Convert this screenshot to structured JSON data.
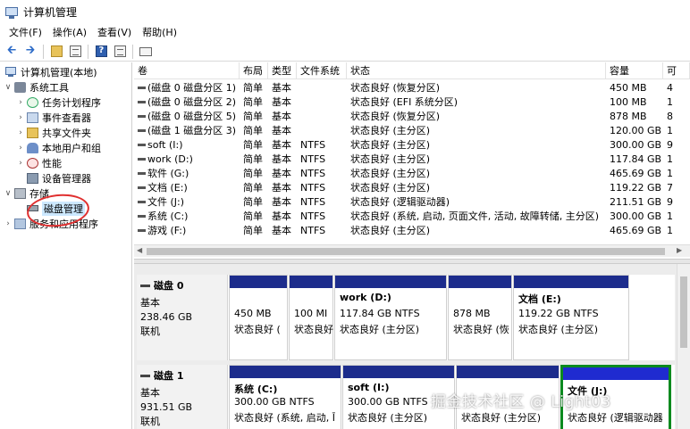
{
  "window": {
    "title": "计算机管理"
  },
  "menu": [
    "文件(F)",
    "操作(A)",
    "查看(V)",
    "帮助(H)"
  ],
  "tree": {
    "root": "计算机管理(本地)",
    "system_tools": "系统工具",
    "task_scheduler": "任务计划程序",
    "event_viewer": "事件查看器",
    "shared_folders": "共享文件夹",
    "local_users": "本地用户和组",
    "performance": "性能",
    "device_manager": "设备管理器",
    "storage": "存储",
    "disk_management": "磁盘管理",
    "services": "服务和应用程序"
  },
  "volume_list": {
    "columns": [
      "卷",
      "布局",
      "类型",
      "文件系统",
      "状态",
      "容量",
      "可"
    ],
    "rows": [
      [
        "(磁盘 0 磁盘分区 1)",
        "简单",
        "基本",
        "",
        "状态良好 (恢复分区)",
        "450 MB",
        "4"
      ],
      [
        "(磁盘 0 磁盘分区 2)",
        "简单",
        "基本",
        "",
        "状态良好 (EFI 系统分区)",
        "100 MB",
        "1"
      ],
      [
        "(磁盘 0 磁盘分区 5)",
        "简单",
        "基本",
        "",
        "状态良好 (恢复分区)",
        "878 MB",
        "8"
      ],
      [
        "(磁盘 1 磁盘分区 3)",
        "简单",
        "基本",
        "",
        "状态良好 (主分区)",
        "120.00 GB",
        "1"
      ],
      [
        "soft (I:)",
        "简单",
        "基本",
        "NTFS",
        "状态良好 (主分区)",
        "300.00 GB",
        "9"
      ],
      [
        "work (D:)",
        "简单",
        "基本",
        "NTFS",
        "状态良好 (主分区)",
        "117.84 GB",
        "1"
      ],
      [
        "软件 (G:)",
        "简单",
        "基本",
        "NTFS",
        "状态良好 (主分区)",
        "465.69 GB",
        "1"
      ],
      [
        "文档 (E:)",
        "简单",
        "基本",
        "NTFS",
        "状态良好 (主分区)",
        "119.22 GB",
        "7"
      ],
      [
        "文件 (J:)",
        "简单",
        "基本",
        "NTFS",
        "状态良好 (逻辑驱动器)",
        "211.51 GB",
        "9"
      ],
      [
        "系统 (C:)",
        "简单",
        "基本",
        "NTFS",
        "状态良好 (系统, 启动, 页面文件, 活动, 故障转储, 主分区)",
        "300.00 GB",
        "1"
      ],
      [
        "游戏 (F:)",
        "简单",
        "基本",
        "NTFS",
        "状态良好 (主分区)",
        "465.69 GB",
        "1"
      ]
    ]
  },
  "disks": [
    {
      "name": "磁盘 0",
      "type": "基本",
      "size": "238.46 GB",
      "status": "联机",
      "partitions": [
        {
          "name": "",
          "size": "450 MB",
          "status": "状态良好 ("
        },
        {
          "name": "",
          "size": "100 MI",
          "status": "状态良好"
        },
        {
          "name": "work (D:)",
          "size": "117.84 GB NTFS",
          "status": "状态良好 (主分区)"
        },
        {
          "name": "",
          "size": "878 MB",
          "status": "状态良好 (恢"
        },
        {
          "name": "文档 (E:)",
          "size": "119.22 GB NTFS",
          "status": "状态良好 (主分区)"
        }
      ]
    },
    {
      "name": "磁盘 1",
      "type": "基本",
      "size": "931.51 GB",
      "status": "联机",
      "partitions": [
        {
          "name": "系统 (C:)",
          "size": "300.00 GB NTFS",
          "status": "状态良好 (系统, 启动, Ī"
        },
        {
          "name": "soft (I:)",
          "size": "300.00 GB NTFS",
          "status": "状态良好 (主分区)"
        },
        {
          "name": "",
          "size": "",
          "status": "状态良好 (主分区)"
        },
        {
          "name": "文件 (J:)",
          "size": "",
          "status": "状态良好 (逻辑驱动器"
        }
      ]
    }
  ],
  "watermark": "掘金技术社区 @ Light03"
}
